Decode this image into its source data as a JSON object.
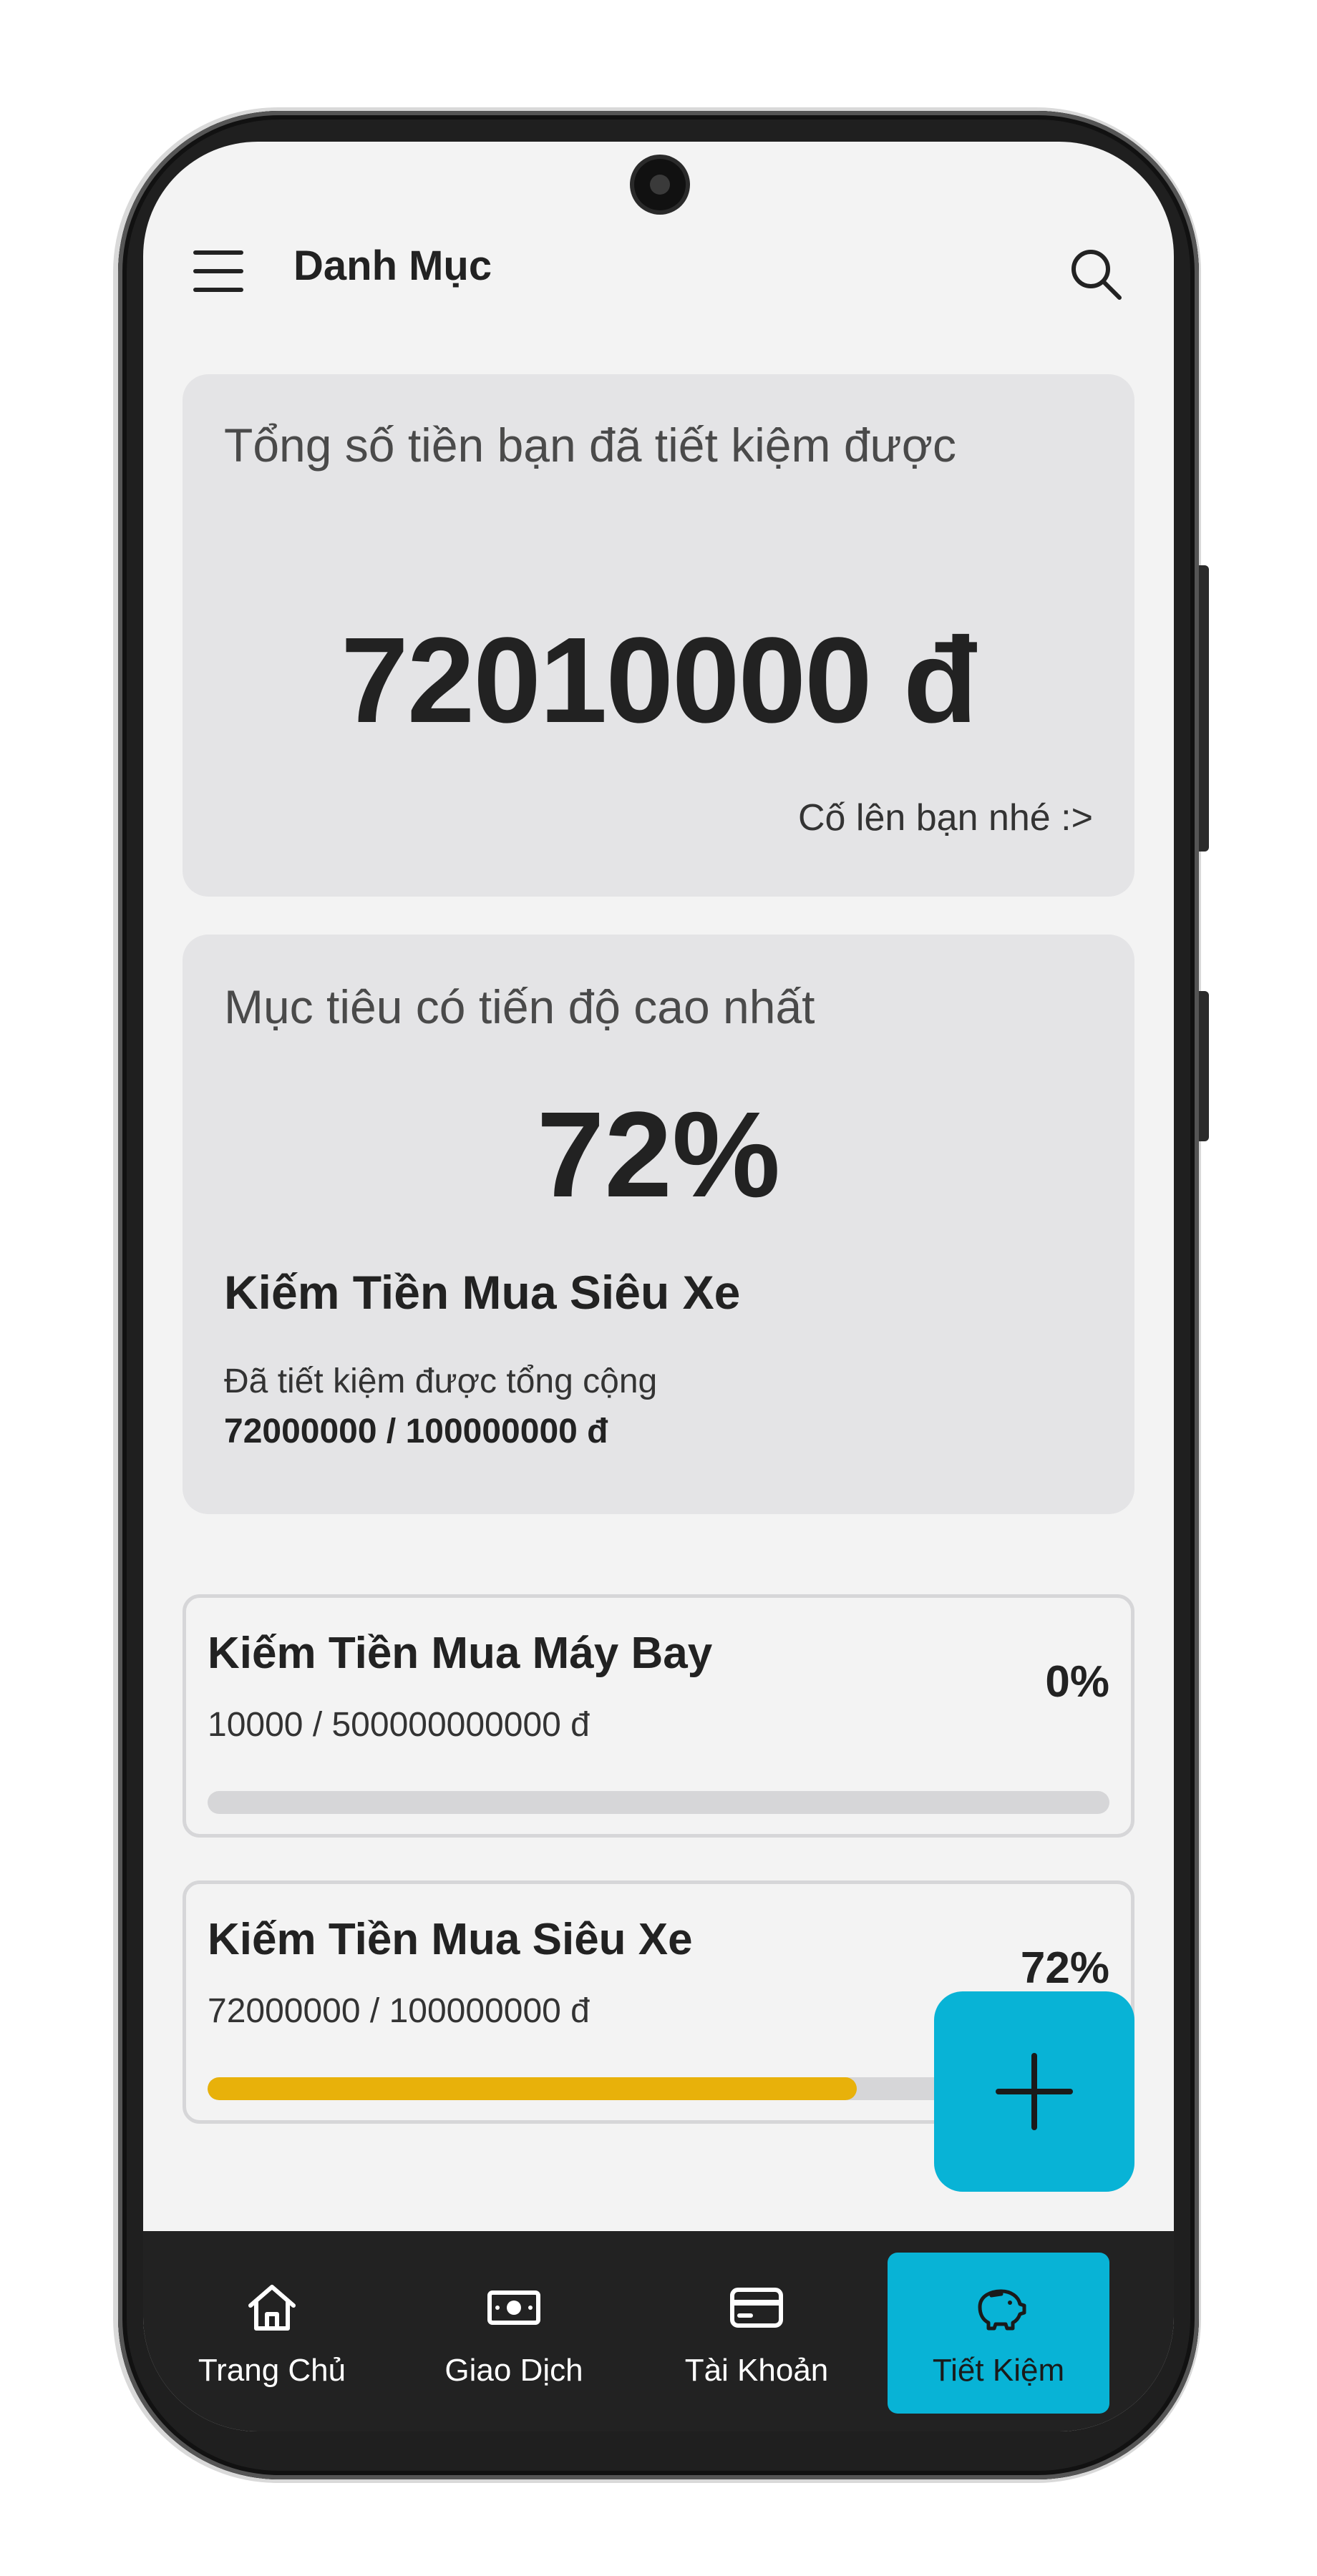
{
  "colors": {
    "accent": "#08b3d6",
    "progress_fill": "#e8b10a",
    "progress_track": "#d6d6d8",
    "card_bg": "#e4e4e6",
    "nav_bg": "#222222"
  },
  "header": {
    "title": "Danh Mục",
    "menu_icon": "hamburger-menu-icon",
    "search_icon": "search-icon"
  },
  "summary": {
    "label": "Tổng số tiền bạn đã tiết kiệm được",
    "value": "72010000 đ",
    "note": "Cố lên bạn nhé :>"
  },
  "top_goal": {
    "label": "Mục tiêu có tiến độ cao nhất",
    "percent": "72%",
    "name": "Kiếm Tiền Mua Siêu Xe",
    "subtitle": "Đã tiết kiệm được tổng cộng",
    "amount": "72000000 / 100000000 đ"
  },
  "goals": [
    {
      "name": "Kiếm Tiền Mua Máy Bay",
      "amount": "10000 / 500000000000 đ",
      "percent_label": "0%",
      "progress": 0.0
    },
    {
      "name": "Kiếm Tiền Mua Siêu Xe",
      "amount": "72000000 / 100000000 đ",
      "percent_label": "72%",
      "progress": 0.72
    }
  ],
  "fab": {
    "icon": "plus-icon"
  },
  "bottom_nav": {
    "items": [
      {
        "label": "Trang Chủ",
        "icon": "home-icon",
        "active": false
      },
      {
        "label": "Giao Dịch",
        "icon": "cash-icon",
        "active": false
      },
      {
        "label": "Tài Khoản",
        "icon": "card-icon",
        "active": false
      },
      {
        "label": "Tiết Kiệm",
        "icon": "piggy-bank-icon",
        "active": true
      }
    ]
  }
}
